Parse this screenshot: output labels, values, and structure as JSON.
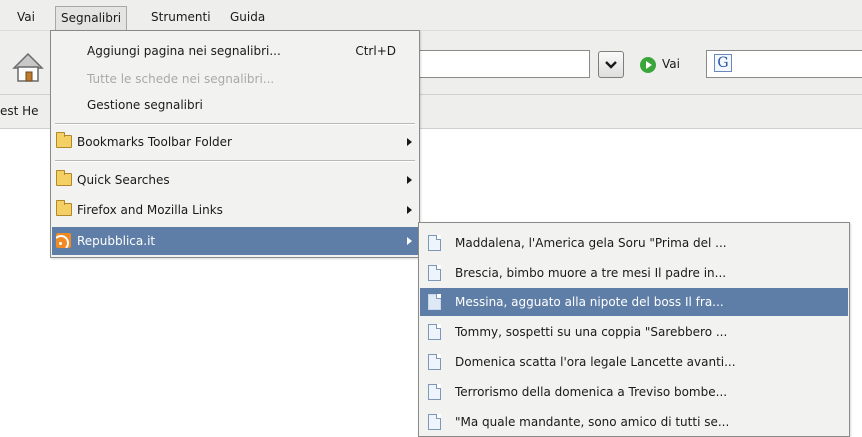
{
  "menubar": {
    "items": [
      {
        "label": "Vai"
      },
      {
        "label": "Segnalibri"
      },
      {
        "label": "Strumenti"
      },
      {
        "label": "Guida"
      }
    ]
  },
  "navbar": {
    "go_label": "Vai",
    "home_icon": "home-icon",
    "go_icon": "go-arrow-icon",
    "search_engine_icon": "google-icon"
  },
  "bookmarks_toolbar": {
    "partial_label": "est He"
  },
  "bookmarks_menu": {
    "items": [
      {
        "label": "Aggiungi pagina nei segnalibri...",
        "shortcut": "Ctrl+D"
      },
      {
        "label": "Tutte le schede nei segnalibri...",
        "disabled": true
      },
      {
        "label": "Gestione segnalibri"
      },
      {
        "label": "Bookmarks Toolbar Folder",
        "submenu": true,
        "icon": "folder-icon"
      },
      {
        "label": "Quick Searches",
        "submenu": true,
        "icon": "folder-icon"
      },
      {
        "label": "Firefox and Mozilla Links",
        "submenu": true,
        "icon": "folder-icon"
      },
      {
        "label": "Repubblica.it",
        "submenu": true,
        "icon": "rss-icon",
        "highlighted": true
      }
    ]
  },
  "feed_submenu": {
    "items": [
      {
        "label": "Maddalena, l'America gela Soru \"Prima del ..."
      },
      {
        "label": "Brescia, bimbo muore a tre mesi Il padre in..."
      },
      {
        "label": "Messina, agguato alla nipote del boss Il fra...",
        "highlighted": true
      },
      {
        "label": "Tommy, sospetti su una coppia \"Sarebbero ..."
      },
      {
        "label": "Domenica scatta l'ora legale Lancette avanti..."
      },
      {
        "label": "Terrorismo della domenica a Treviso bombe..."
      },
      {
        "label": "\"Ma quale mandante, sono amico di tutti se..."
      }
    ]
  },
  "colors": {
    "highlight": "#5f7ea7",
    "menu_bg": "#f2f2f0",
    "toolbar_bg": "#eeeeec"
  }
}
